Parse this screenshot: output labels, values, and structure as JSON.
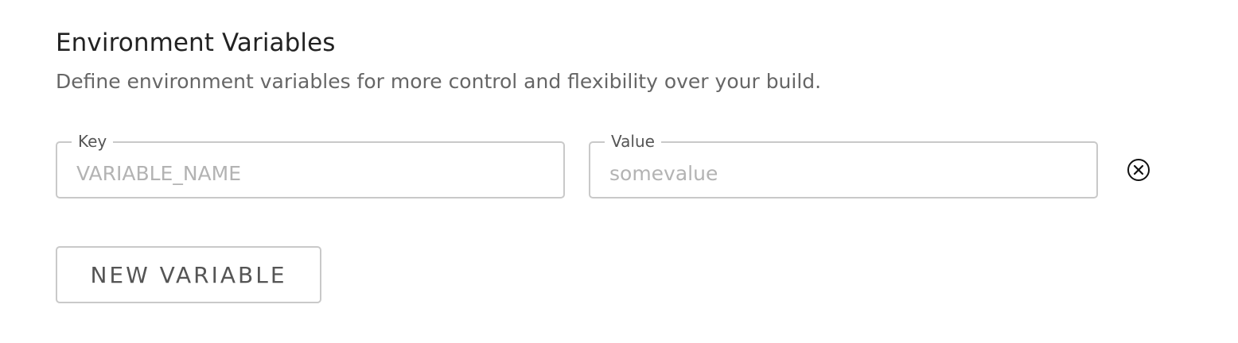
{
  "section": {
    "title": "Environment Variables",
    "description": "Define environment variables for more control and flexibility over your build."
  },
  "variables": [
    {
      "key": {
        "label": "Key",
        "value": "",
        "placeholder": "VARIABLE_NAME"
      },
      "value": {
        "label": "Value",
        "value": "",
        "placeholder": "somevalue"
      },
      "remove_icon": "close-circle-icon"
    }
  ],
  "actions": {
    "new_variable_label": "NEW VARIABLE"
  }
}
